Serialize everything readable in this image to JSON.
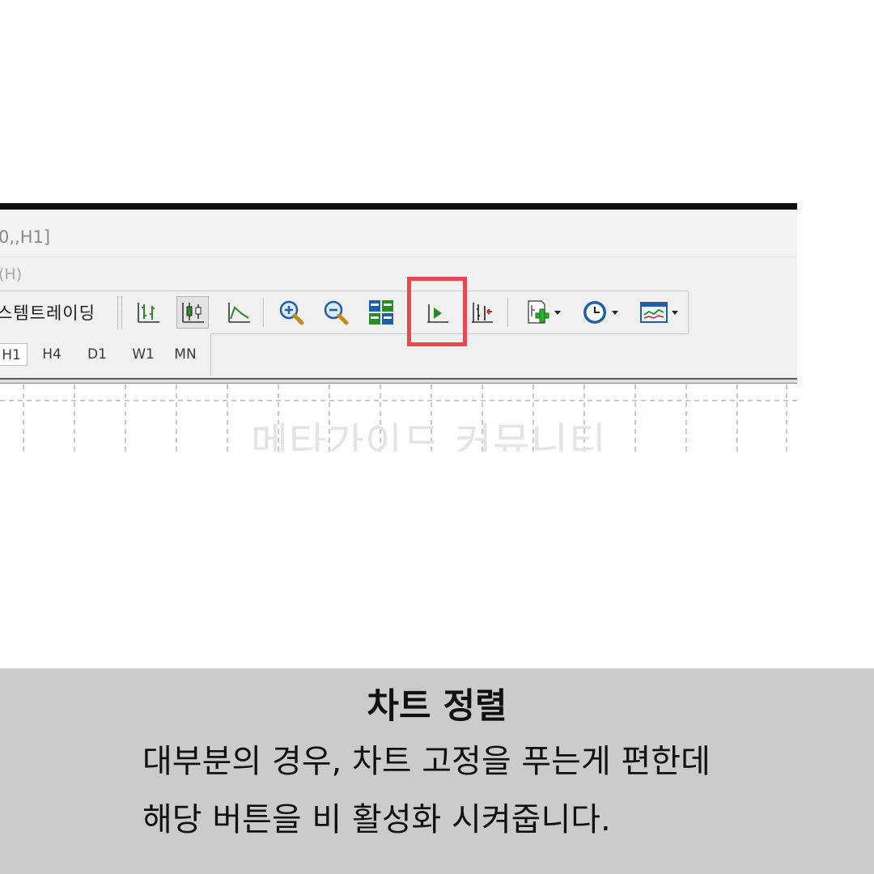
{
  "window": {
    "title_fragment": "0,,H1]",
    "menu_fragment": "(H)"
  },
  "toolbar": {
    "systrade_label": "스템트레이딩",
    "buttons": [
      {
        "name": "bar-chart",
        "icon": "bar-chart-icon"
      },
      {
        "name": "candlestick-chart",
        "icon": "candlestick-icon",
        "pressed": true
      },
      {
        "name": "line-chart",
        "icon": "line-chart-icon"
      },
      {
        "name": "zoom-in",
        "icon": "zoom-in-icon"
      },
      {
        "name": "zoom-out",
        "icon": "zoom-out-icon"
      },
      {
        "name": "tile-windows",
        "icon": "tile-windows-icon"
      },
      {
        "name": "auto-scroll",
        "icon": "auto-scroll-icon",
        "highlighted": true
      },
      {
        "name": "chart-shift",
        "icon": "chart-shift-icon"
      },
      {
        "name": "indicators",
        "icon": "add-indicator-icon",
        "dropdown": true
      },
      {
        "name": "periods",
        "icon": "clock-icon",
        "dropdown": true
      },
      {
        "name": "templates",
        "icon": "template-icon",
        "dropdown": true
      }
    ]
  },
  "periods": {
    "items": [
      "H1",
      "H4",
      "D1",
      "W1",
      "MN"
    ],
    "active": "H1"
  },
  "chart": {
    "watermark": "메타가이드 커뮤니티"
  },
  "caption": {
    "title": "차트 정렬",
    "line1": "대부분의 경우, 차트 고정을 푸는게 편한데",
    "line2": "해당 버튼을 비 활성화 시켜줍니다."
  },
  "colors": {
    "highlight": "#e8484d",
    "caption_bg": "#cbcbcb",
    "icon_green": "#2a8a2a",
    "icon_blue": "#1f5fa8"
  }
}
